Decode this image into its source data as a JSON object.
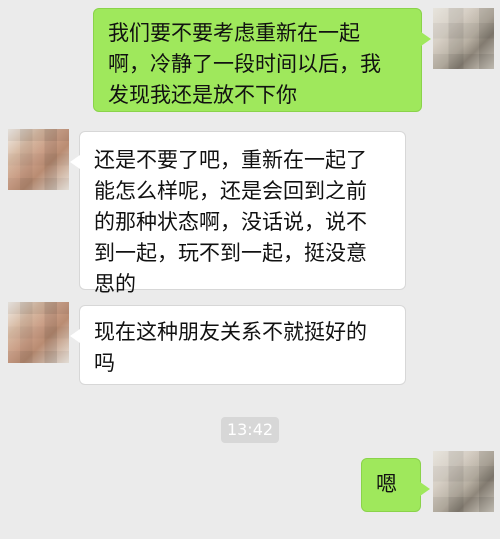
{
  "chat": {
    "messages": [
      {
        "side": "sent",
        "text": "我们要不要考虑重新在一起\n啊，冷静了一段时间以后，我\n发现我还是放不下你"
      },
      {
        "side": "received",
        "text": "还是不要了吧，重新在一起了\n能怎么样呢，还是会回到之前\n的那种状态啊，没话说，说不\n到一起，玩不到一起，挺没意\n思的"
      },
      {
        "side": "received",
        "text": "现在这种朋友关系不就挺好的\n吗"
      },
      {
        "side": "timestamp",
        "text": "13:42"
      },
      {
        "side": "sent",
        "text": "嗯"
      }
    ]
  },
  "colors": {
    "background": "#ebebeb",
    "sent_bubble": "#9fe85c",
    "received_bubble": "#ffffff",
    "timestamp_bg": "#d7d7d7"
  },
  "icons": {
    "avatar_self": "blurred-avatar-self",
    "avatar_peer": "blurred-avatar-peer"
  }
}
